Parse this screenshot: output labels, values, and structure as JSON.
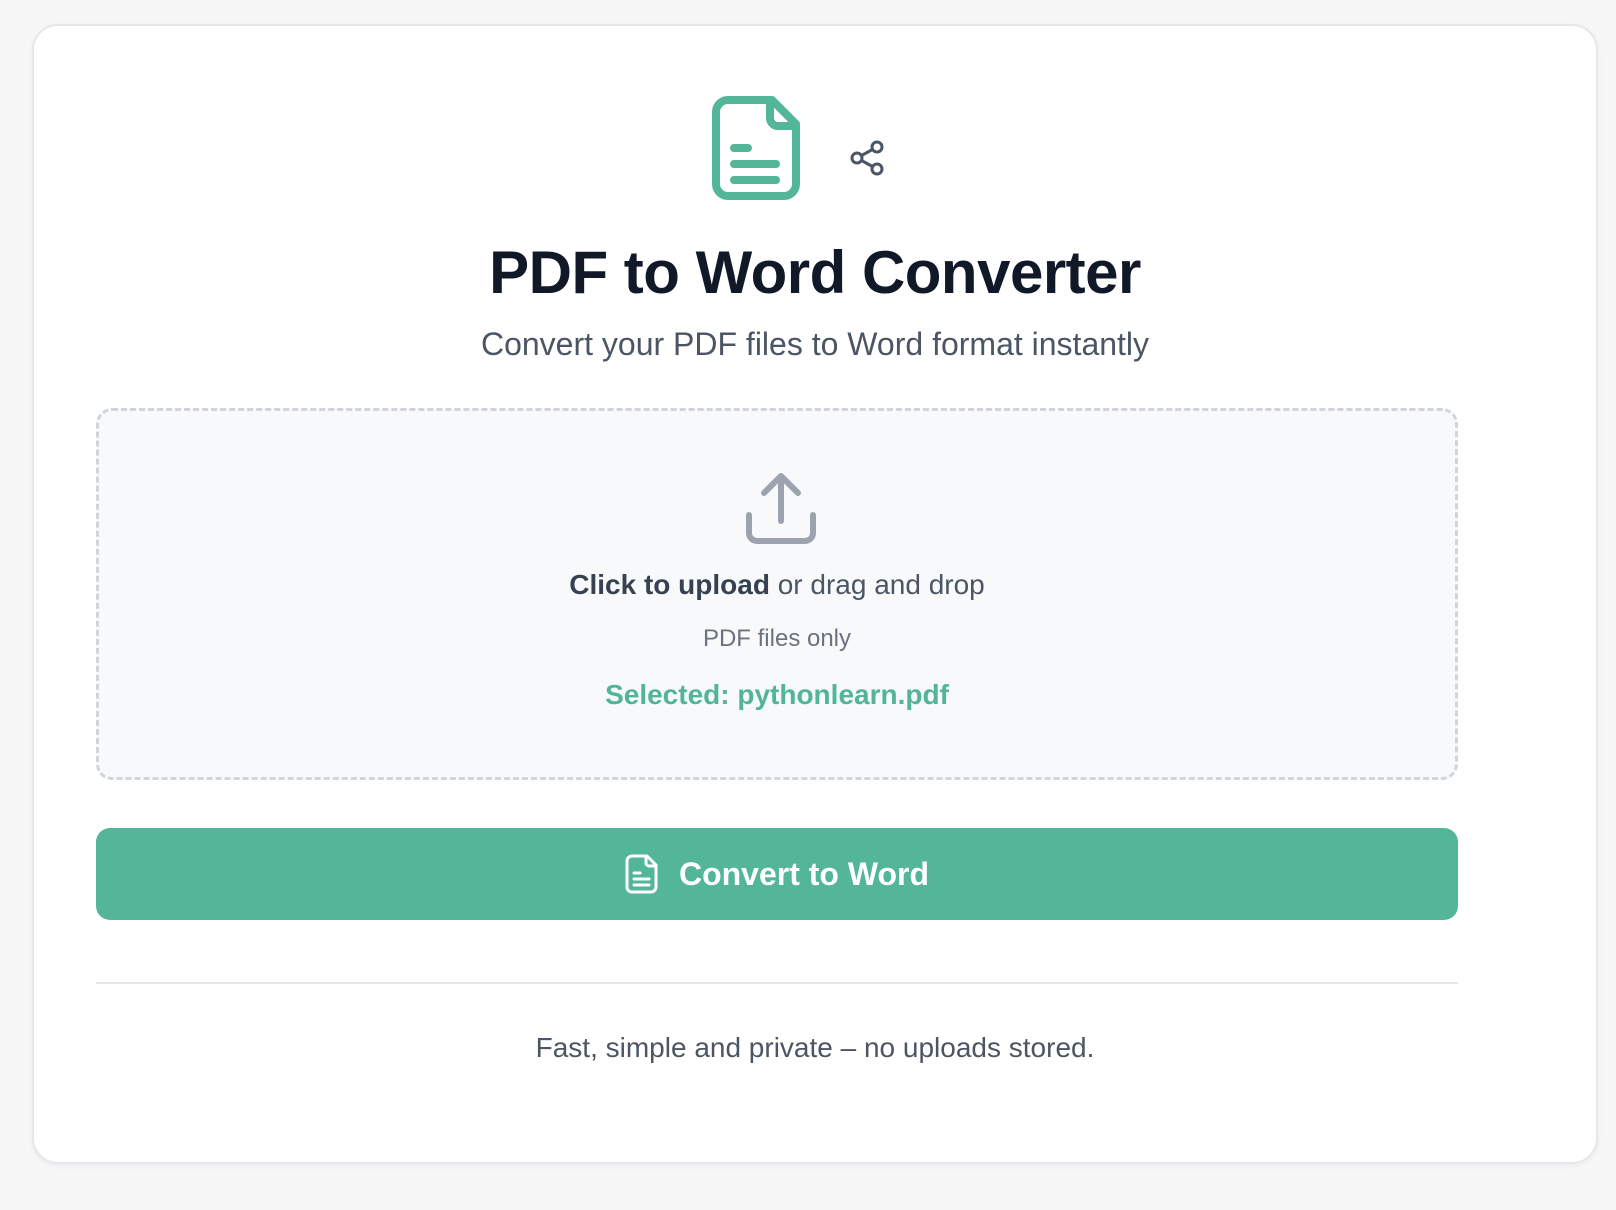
{
  "app": {
    "title": "PDF to Word Converter",
    "subtitle": "Convert your PDF files to Word format instantly"
  },
  "header": {
    "logo_icon": "document-icon",
    "share_icon": "share-icon"
  },
  "upload": {
    "icon": "upload-icon",
    "action_strong": "Click to upload",
    "action_rest": " or drag and drop",
    "hint": "PDF files only",
    "selected_text": "Selected: pythonlearn.pdf"
  },
  "convert_button": {
    "icon": "document-icon",
    "label": "Convert to Word"
  },
  "footer": {
    "text": "Fast, simple and private – no uploads stored."
  },
  "colors": {
    "accent": "#54b698",
    "title": "#111827",
    "text": "#4b5563",
    "dropzone_bg": "#f8f9fb",
    "border": "#d1d5db"
  }
}
